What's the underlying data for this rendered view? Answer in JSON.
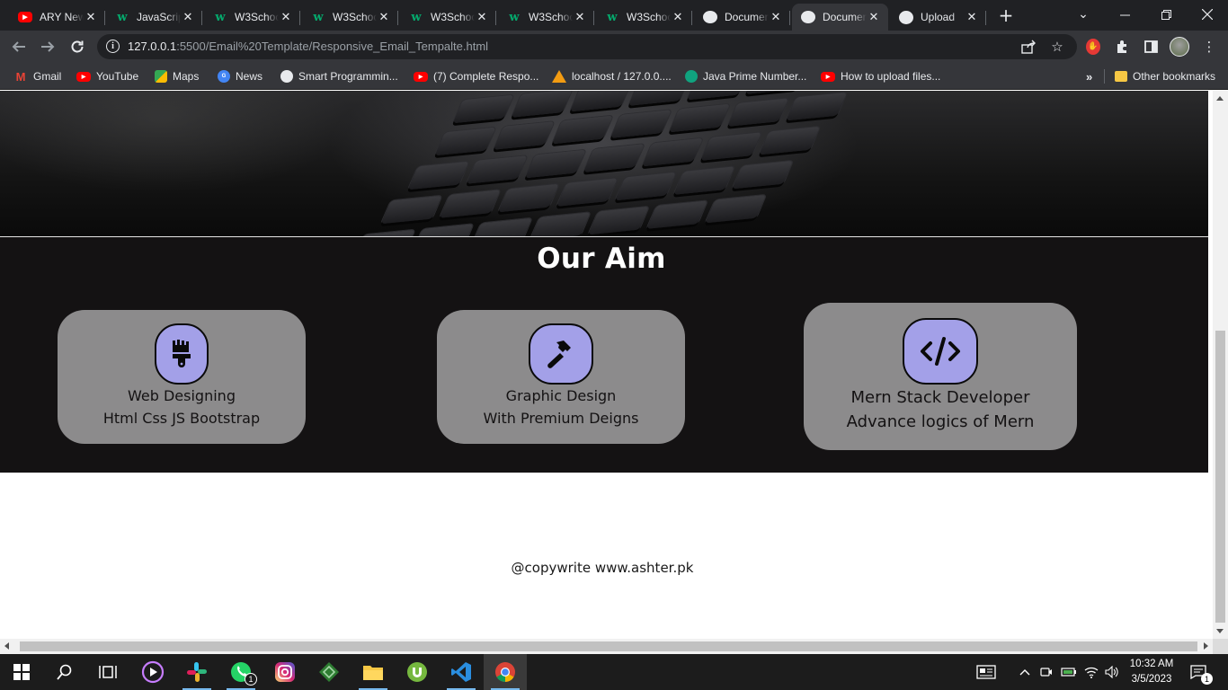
{
  "browser": {
    "tabs": [
      {
        "title": "ARY News",
        "favicon": "youtube-icon",
        "active": false
      },
      {
        "title": "JavaScript",
        "favicon": "w3schools-icon",
        "active": false
      },
      {
        "title": "W3Schools",
        "favicon": "w3schools-icon",
        "active": false
      },
      {
        "title": "W3Schools",
        "favicon": "w3schools-icon",
        "active": false
      },
      {
        "title": "W3Schools",
        "favicon": "w3schools-icon",
        "active": false
      },
      {
        "title": "W3Schools",
        "favicon": "w3schools-icon",
        "active": false
      },
      {
        "title": "W3Schools",
        "favicon": "w3schools-icon",
        "active": false
      },
      {
        "title": "Document",
        "favicon": "globe-icon",
        "active": false
      },
      {
        "title": "Document",
        "favicon": "globe-icon",
        "active": true
      },
      {
        "title": "Upload",
        "favicon": "github-icon",
        "active": false
      }
    ],
    "close_glyph": "✕",
    "new_tab_glyph": "+",
    "url_host": "127.0.0.1",
    "url_rest": ":5500/Email%20Template/Responsive_Email_Tempalte.html",
    "bookmarks": [
      {
        "label": "Gmail",
        "icon": "gmail-icon"
      },
      {
        "label": "YouTube",
        "icon": "youtube-icon"
      },
      {
        "label": "Maps",
        "icon": "maps-icon"
      },
      {
        "label": "News",
        "icon": "news-icon"
      },
      {
        "label": "Smart Programmin...",
        "icon": "smart-programming-icon"
      },
      {
        "label": "(7) Complete Respo...",
        "icon": "youtube-icon"
      },
      {
        "label": "localhost / 127.0.0....",
        "icon": "phpmyadmin-icon"
      },
      {
        "label": "Java Prime Number...",
        "icon": "chatgpt-icon"
      },
      {
        "label": "How to upload files...",
        "icon": "youtube-icon"
      }
    ],
    "bookmarks_overflow": "»",
    "other_bookmarks": "Other bookmarks"
  },
  "page": {
    "aim_title": "Our Aim",
    "cards": [
      {
        "line1": "Web Designing",
        "line2": "Html Css JS Bootstrap",
        "icon": "paint-brush-icon"
      },
      {
        "line1": "Graphic Design",
        "line2": "With Premium Deigns",
        "icon": "hammer-icon"
      },
      {
        "line1": "Mern Stack Developer",
        "line2": "Advance logics of Mern",
        "icon": "code-icon"
      }
    ],
    "footer": "@copywrite www.ashter.pk"
  },
  "taskbar": {
    "whatsapp_badge": "1",
    "time": "10:32 AM",
    "date": "3/5/2023",
    "notification_count": "1"
  },
  "colors": {
    "aim_background": "#141213",
    "card_background": "#8c8b8c",
    "icon_background": "#a3a0e8",
    "chrome_frame": "#202124"
  }
}
